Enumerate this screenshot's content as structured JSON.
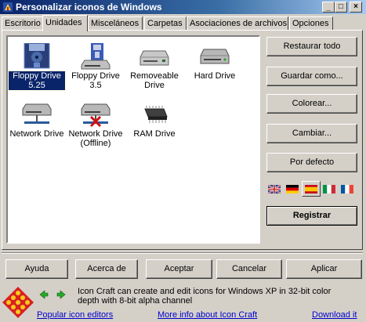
{
  "window": {
    "title": "Personalizar iconos de Windows"
  },
  "tabs": [
    {
      "label": "Escritorio"
    },
    {
      "label": "Unidades"
    },
    {
      "label": "Misceláneos"
    },
    {
      "label": "Carpetas"
    },
    {
      "label": "Asociaciones de archivos"
    },
    {
      "label": "Opciones"
    }
  ],
  "active_tab": "Unidades",
  "drives": [
    {
      "label": "Floppy Drive 5.25",
      "icon": "floppy-525-icon",
      "selected": true
    },
    {
      "label": "Floppy Drive 3.5",
      "icon": "floppy-35-icon"
    },
    {
      "label": "Removeable Drive",
      "icon": "removable-drive-icon"
    },
    {
      "label": "Hard Drive",
      "icon": "hard-drive-icon"
    },
    {
      "label": "Network Drive",
      "icon": "network-drive-icon"
    },
    {
      "label": "Network Drive (Offline)",
      "icon": "network-drive-offline-icon"
    },
    {
      "label": "RAM Drive",
      "icon": "ram-drive-icon"
    }
  ],
  "side_buttons": {
    "restore_all": "Restaurar todo",
    "save_as": "Guardar como...",
    "colorize": "Colorear...",
    "change": "Cambiar...",
    "default": "Por defecto",
    "register": "Registrar"
  },
  "languages": [
    "english-flag-icon",
    "german-flag-icon",
    "spanish-flag-icon",
    "italian-flag-icon",
    "french-flag-icon"
  ],
  "bottom_buttons": {
    "help": "Ayuda",
    "about": "Acerca de",
    "accept": "Aceptar",
    "cancel": "Cancelar",
    "apply": "Aplicar"
  },
  "promo": {
    "text": "Icon Craft can create and edit icons for Windows XP in 32-bit color depth with 8-bit alpha channel",
    "link_popular": "Popular icon editors",
    "link_more": "More info about Icon Craft",
    "link_download": "Download it"
  },
  "colors": {
    "titlebar": "#0a246a",
    "selection": "#0a246a",
    "link": "#0000cc"
  }
}
